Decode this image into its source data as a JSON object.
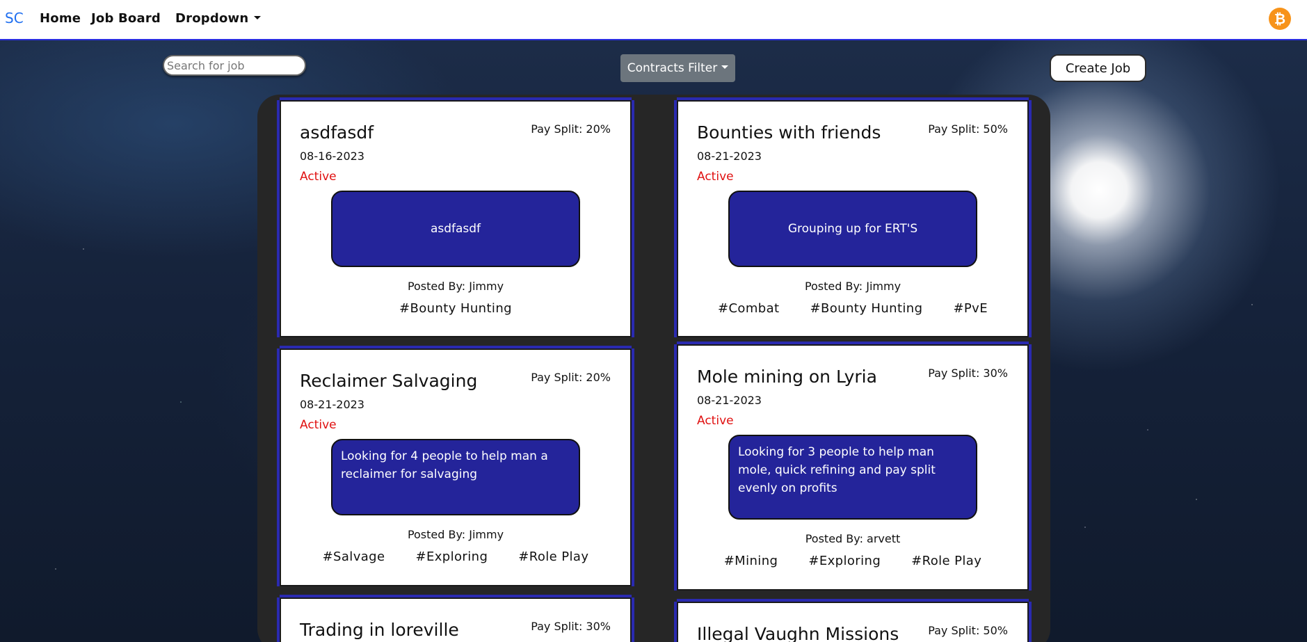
{
  "nav": {
    "brand": "SC",
    "links": [
      "Home",
      "Job Board",
      "Dropdown"
    ],
    "coin_glyph": "₿"
  },
  "controls": {
    "search_placeholder": "Search for job",
    "filter_label": "Contracts Filter",
    "create_label": "Create Job"
  },
  "jobs": [
    {
      "title": "asdfasdf",
      "pay": "Pay Split: 20%",
      "date": "08-16-2023",
      "status": "Active",
      "description": "asdfasdf",
      "posted": "Posted By: Jimmy",
      "tags": [
        "#Bounty Hunting"
      ]
    },
    {
      "title": "Bounties with friends",
      "pay": "Pay Split: 50%",
      "date": "08-21-2023",
      "status": "Active",
      "description": "Grouping up for ERT'S",
      "posted": "Posted By: Jimmy",
      "tags": [
        "#Combat",
        "#Bounty Hunting",
        "#PvE"
      ]
    },
    {
      "title": "Reclaimer Salvaging",
      "pay": "Pay Split: 20%",
      "date": "08-21-2023",
      "status": "Active",
      "description": "Looking for 4 people to help man a reclaimer for salvaging",
      "posted": "Posted By: Jimmy",
      "tags": [
        "#Salvage",
        "#Exploring",
        "#Role Play"
      ]
    },
    {
      "title": "Mole mining on Lyria",
      "pay": "Pay Split: 30%",
      "date": "08-21-2023",
      "status": "Active",
      "description": "Looking for 3 people to help man mole, quick refining and pay split evenly on profits",
      "posted": "Posted By: arvett",
      "tags": [
        "#Mining",
        "#Exploring",
        "#Role Play"
      ]
    },
    {
      "title": "Trading in loreville",
      "pay": "Pay Split: 30%"
    },
    {
      "title": "Illegal Vaughn Missions",
      "pay": "Pay Split: 50%"
    }
  ],
  "colors": {
    "brand": "#1f6ff0",
    "nav_border": "#2b2ee0",
    "status_active": "#e01010",
    "description_bg": "#24249a",
    "filter_bg": "#6c757d",
    "board_bg": "#262626"
  }
}
